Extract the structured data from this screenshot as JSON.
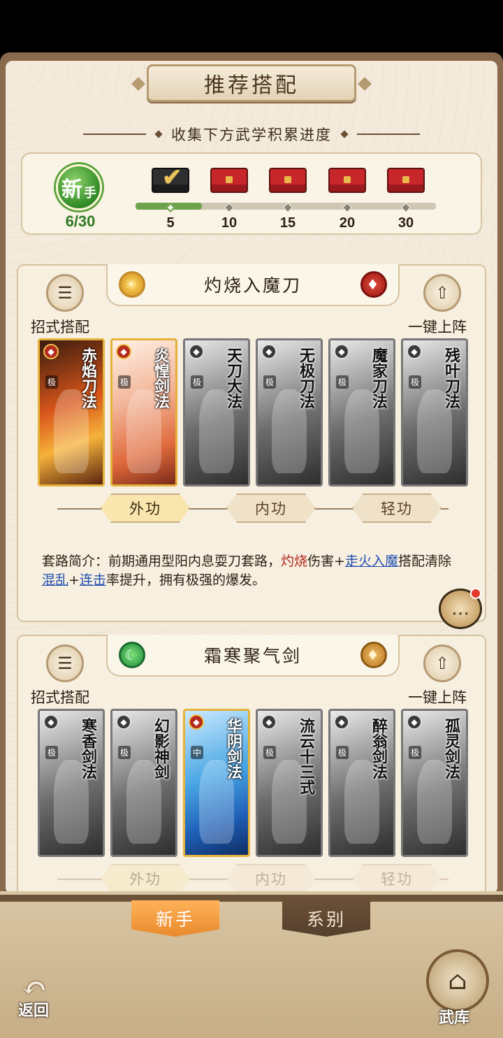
{
  "title": "推荐搭配",
  "subtitle": "收集下方武学积累进度",
  "progress": {
    "badge_main": "新",
    "badge_sub": "手",
    "count": "6/30",
    "fill_fraction": 0.22,
    "milestones": [
      {
        "value": "5",
        "reached": true,
        "opened": true
      },
      {
        "value": "10",
        "reached": false,
        "opened": false
      },
      {
        "value": "15",
        "reached": false,
        "opened": false
      },
      {
        "value": "20",
        "reached": false,
        "opened": false
      },
      {
        "value": "30",
        "reached": false,
        "opened": false
      }
    ]
  },
  "combos": [
    {
      "title": "灼烧入魔刀",
      "left_button": "招式搭配",
      "right_button": "一键上阵",
      "left_icon": "sun-icon",
      "right_icon": "blade-icon",
      "cards": [
        {
          "name": "赤焰刀法",
          "tier": "极",
          "owned": true,
          "style": "fire"
        },
        {
          "name": "炎惶剑法",
          "tier": "极",
          "owned": true,
          "style": "pink"
        },
        {
          "name": "天刀大法",
          "tier": "极",
          "owned": false
        },
        {
          "name": "无极刀法",
          "tier": "极",
          "owned": false
        },
        {
          "name": "魔家刀法",
          "tier": "极",
          "owned": false
        },
        {
          "name": "残叶刀法",
          "tier": "极",
          "owned": false
        }
      ],
      "tabs": [
        "外功",
        "内功",
        "轻功"
      ],
      "description": {
        "prefix": "套路简介：前期通用型阳内息耍刀套路，",
        "kw1": "灼烧",
        "mid1": "伤害+",
        "kw2": "走火入魔",
        "mid2": "搭配清除",
        "kw3": "混乱",
        "mid3": "+",
        "kw4": "连击",
        "suffix": "率提升，拥有极强的爆发。"
      }
    },
    {
      "title": "霜寒聚气剑",
      "left_button": "招式搭配",
      "right_button": "一键上阵",
      "left_icon": "moon-icon",
      "right_icon": "sword-icon",
      "cards": [
        {
          "name": "寒香剑法",
          "tier": "极",
          "owned": false
        },
        {
          "name": "幻影神剑",
          "tier": "极",
          "owned": false
        },
        {
          "name": "华阴剑法",
          "tier": "中",
          "owned": true,
          "style": "blue"
        },
        {
          "name": "流云十三式",
          "tier": "极",
          "owned": false
        },
        {
          "name": "醉翁剑法",
          "tier": "极",
          "owned": false
        },
        {
          "name": "孤灵剑法",
          "tier": "极",
          "owned": false
        }
      ],
      "tabs": [
        "外功",
        "内功",
        "轻功"
      ]
    }
  ],
  "bottom": {
    "tab_active": "新手",
    "tab_inactive": "系别",
    "back_label": "返回",
    "armory_label": "武库"
  }
}
